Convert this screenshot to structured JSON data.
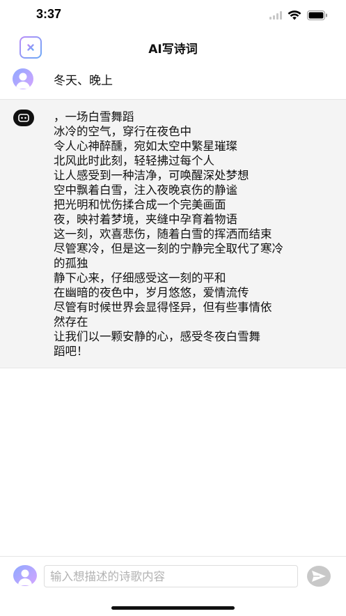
{
  "status_bar": {
    "time": "3:37"
  },
  "header": {
    "title": "AI写诗词"
  },
  "messages": {
    "user": {
      "text": "冬天、晚上"
    },
    "ai": {
      "lines": [
        "，一场白雪舞蹈",
        "冰冷的空气，穿行在夜色中",
        "令人心神醉醺，宛如太空中繁星璀璨",
        "北风此时此刻，轻轻拂过每个人",
        "让人感受到一种洁净，可唤醒深处梦想",
        "空中飘着白雪，注入夜晚哀伤的静谧",
        "把光明和忧伤揉合成一个完美画面",
        "夜，映衬着梦境，夹缝中孕育着物语",
        "这一刻，欢喜悲伤，随着白雪的挥洒而结束",
        "尽管寒冷，但是这一刻的宁静完全取代了寒冷",
        "的孤独",
        "静下心来，仔细感受这一刻的平和",
        "在幽暗的夜色中，岁月悠悠，爱情流传",
        "尽管有时候世界会显得怪异，但有些事情依",
        "然存在",
        "让我们以一颗安静的心，感受冬夜白雪舞",
        "蹈吧！"
      ]
    }
  },
  "input": {
    "placeholder": "输入想描述的诗歌内容",
    "value": ""
  },
  "icons": {
    "back": "close-x-icon",
    "user_avatar": "person-avatar-icon",
    "ai_avatar": "robot-icon",
    "send": "paper-plane-icon",
    "wifi": "wifi-icon",
    "battery": "battery-icon",
    "signal": "signal-icon"
  },
  "colors": {
    "accent_gradient_start": "#b98bf7",
    "accent_gradient_end": "#6aa9f6",
    "ai_bubble_bg": "#f4f4f4",
    "send_disabled": "#c8c8c8"
  }
}
